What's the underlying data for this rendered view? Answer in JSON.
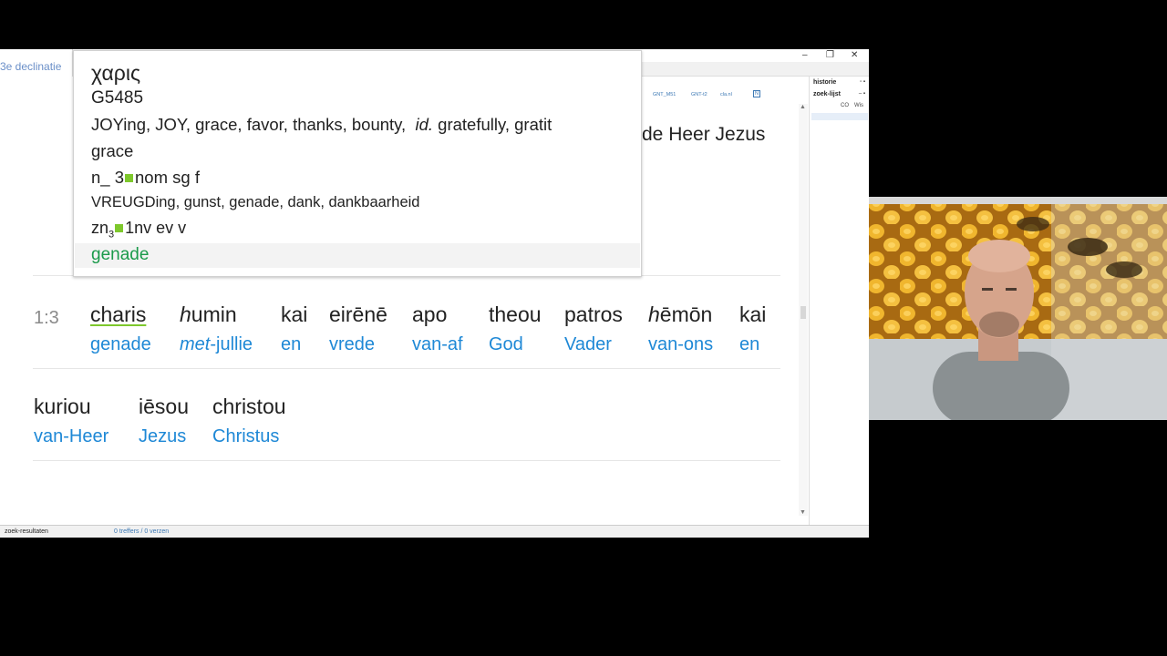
{
  "window": {
    "minimize_glyph": "–",
    "restore_glyph": "❐",
    "close_glyph": "✕"
  },
  "tabs": [
    "GNT_M51",
    "GNT-t2",
    "cla.nl"
  ],
  "tab_badge": "N",
  "left_pane": {
    "label": "3e declinatie"
  },
  "right_pane": {
    "historie": "historie",
    "zoek_lijst": "zoek-lijst",
    "col1": "CO",
    "col2": "Wis"
  },
  "header_fragment": "de Heer Jezus",
  "popup": {
    "lemma": "χαρις",
    "strong": "G5485",
    "gloss_en": "JOYing, JOY, grace, favor, thanks, bounty,",
    "gloss_en_it": "id.",
    "gloss_en_tail": "gratefully, gratit",
    "gloss_en_2": "grace",
    "parse_en_pre": "n_ 3",
    "parse_en_post": "nom sg f",
    "gloss_nl": "VREUGDing, gunst, genade, dank, dankbaarheid",
    "parse_nl_pre": "zn",
    "parse_nl_sub": "3",
    "parse_nl_post": "1nv ev v",
    "selected": "genade"
  },
  "verse": {
    "ref": "1:3",
    "line1": [
      {
        "g": "charis",
        "t": "genade"
      },
      {
        "g_it": "h",
        "g": "umin",
        "t_it": "met",
        "t": "-jullie"
      },
      {
        "g": "kai",
        "t": "en"
      },
      {
        "g": "eirēnē",
        "t": "vrede"
      },
      {
        "g": "apo",
        "t": "van-af"
      },
      {
        "g": "theou",
        "t": "God"
      },
      {
        "g": "patros",
        "t": "Vader"
      },
      {
        "g_it": "h",
        "g": "ēmōn",
        "t": "van-ons"
      },
      {
        "g": "kai",
        "t": "en"
      }
    ],
    "line2": [
      {
        "g": "kuriou",
        "t": "van-Heer"
      },
      {
        "g": "iēsou",
        "t": "Jezus"
      },
      {
        "g": "christou",
        "t": "Christus"
      }
    ]
  },
  "status": {
    "left": "zoek-resultaten",
    "count": "0 treffers / 0 verzen"
  },
  "colors": {
    "greek": "#222222",
    "translation": "#1e88d6",
    "selected": "#1a9a4a",
    "parse_square": "#7ec82c"
  }
}
